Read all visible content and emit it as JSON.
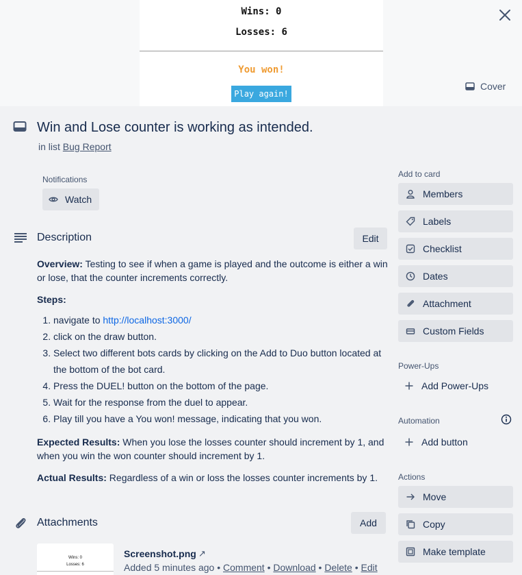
{
  "cover": {
    "wins": "Wins: 0",
    "losses": "Losses: 6",
    "result": "You won!",
    "play_again": "Play again!",
    "cover_button": "Cover"
  },
  "card": {
    "title": "Win and Lose counter is working as intended.",
    "in_list_prefix": "in list",
    "list_name": "Bug Report"
  },
  "notifications": {
    "label": "Notifications",
    "watch": "Watch"
  },
  "description": {
    "heading": "Description",
    "edit": "Edit",
    "overview_label": "Overview:",
    "overview_text": " Testing to see if when a game is played and the outcome is either a win or lose, that the counter increments correctly.",
    "steps_label": "Steps:",
    "step1_prefix": "navigate to ",
    "step1_link": "http://localhost:3000/",
    "step2": "click on the draw button.",
    "step3": "Select two different bots cards by clicking on the Add to Duo button located at the bottom of the bot card.",
    "step4": "Press the DUEL! button on the bottom of the page.",
    "step5": "Wait for the response from the duel to appear.",
    "step6": "Play till you have a You won! message, indicating that you won.",
    "expected_label": "Expected Results:",
    "expected_text": " When you lose the losses counter should increment by 1, and when you win the won counter should increment by 1.",
    "actual_label": "Actual Results:",
    "actual_text": " Regardless of a win or loss the losses counter increments by 1."
  },
  "attachments": {
    "heading": "Attachments",
    "add": "Add",
    "items": [
      {
        "name": "Screenshot.png",
        "ext_icon": "↗",
        "added": "Added 5 minutes ago",
        "comment": "Comment",
        "download": "Download",
        "delete": "Delete",
        "edit": "Edit",
        "thumb_wins": "Wins: 0",
        "thumb_losses": "Losses: 6"
      }
    ]
  },
  "sidebar": {
    "add_to_card": "Add to card",
    "members": "Members",
    "labels": "Labels",
    "checklist": "Checklist",
    "dates": "Dates",
    "attachment": "Attachment",
    "custom_fields": "Custom Fields",
    "power_ups_label": "Power-Ups",
    "add_power_ups": "Add Power-Ups",
    "automation_label": "Automation",
    "add_button": "Add button",
    "actions_label": "Actions",
    "move": "Move",
    "copy": "Copy",
    "make_template": "Make template"
  }
}
